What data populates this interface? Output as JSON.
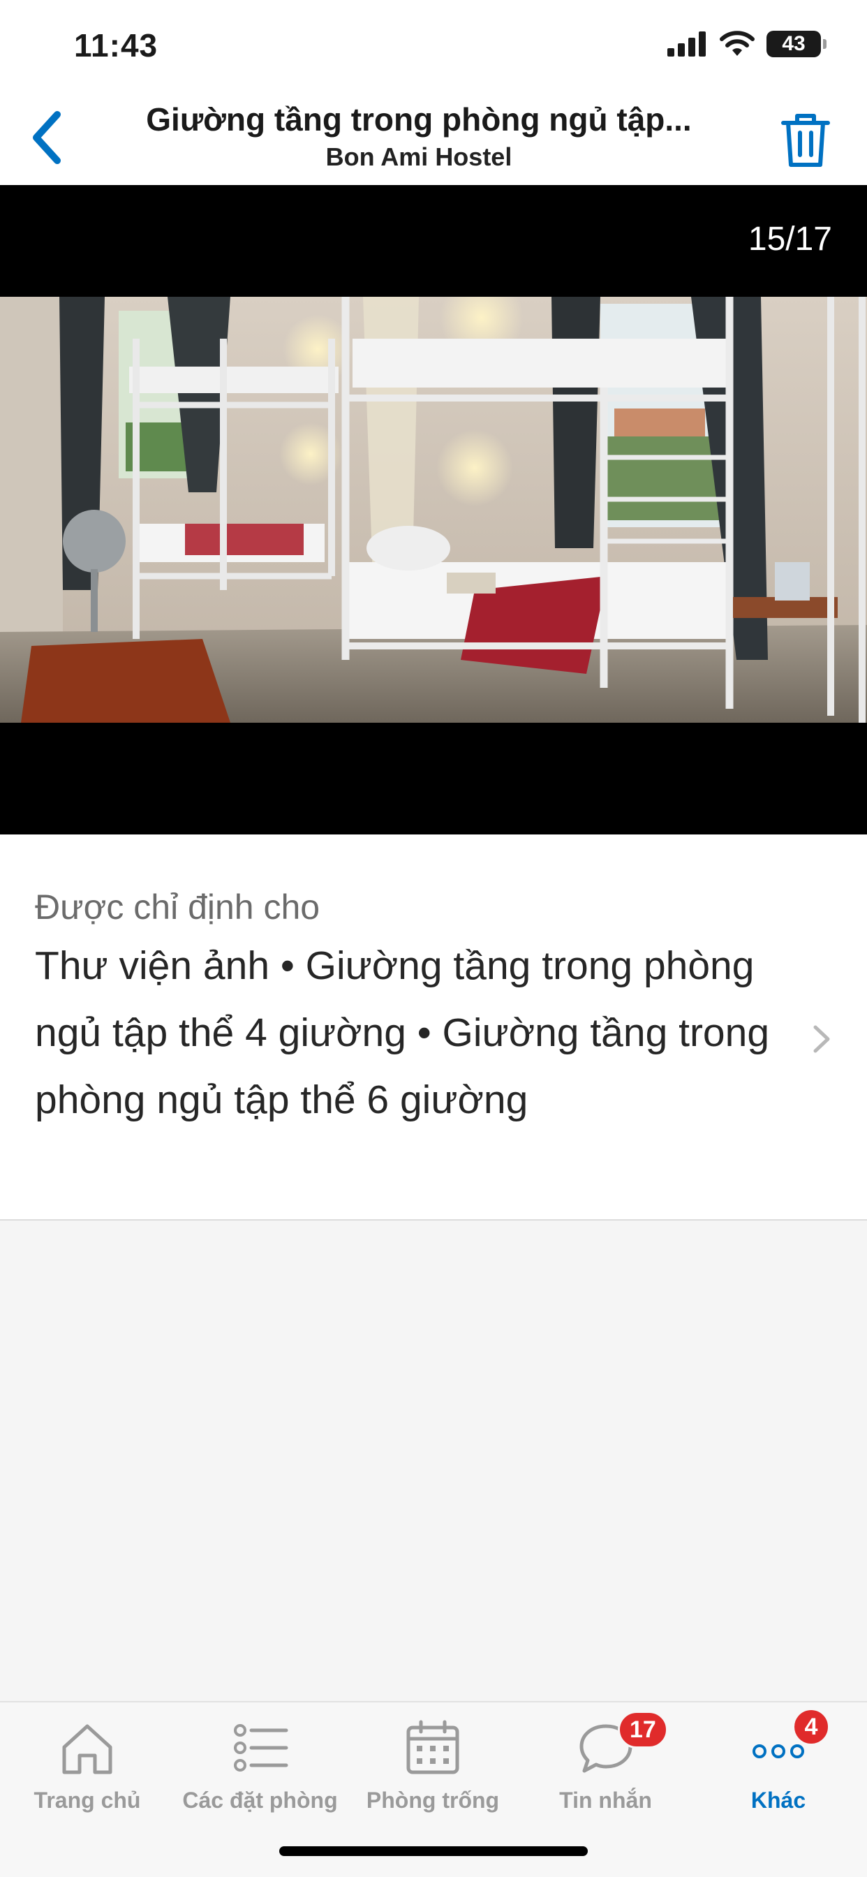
{
  "status_bar": {
    "time": "11:43",
    "battery": "43"
  },
  "header": {
    "title": "Giường tầng trong phòng ngủ tập...",
    "subtitle": "Bon Ami Hostel",
    "accent_color": "#0071c2"
  },
  "photo": {
    "counter": "15/17"
  },
  "assigned": {
    "label": "Được chỉ định cho",
    "value": "Thư viện ảnh • Giường tầng trong phòng ngủ tập thể 4 giường • Giường tầng trong phòng ngủ tập thể 6 giường"
  },
  "tabs": [
    {
      "label": "Trang chủ",
      "icon": "home-icon"
    },
    {
      "label": "Các đặt phòng",
      "icon": "list-icon"
    },
    {
      "label": "Phòng trống",
      "icon": "calendar-icon"
    },
    {
      "label": "Tin nhắn",
      "icon": "chat-icon",
      "badge": "17"
    },
    {
      "label": "Khác",
      "icon": "more-icon",
      "badge": "4",
      "active": true
    }
  ]
}
